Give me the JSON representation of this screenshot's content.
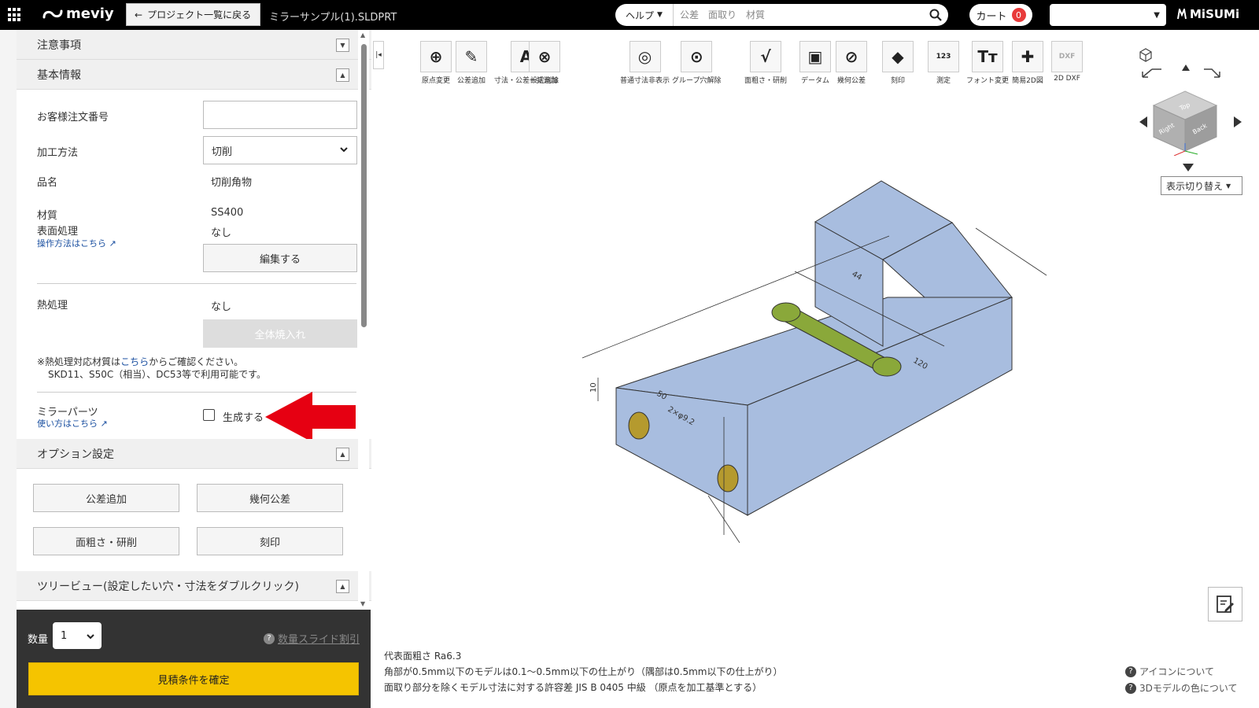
{
  "header": {
    "logo_text": "meviy",
    "back_label": "プロジェクト一覧に戻る",
    "file_name": "ミラーサンプル(1).SLDPRT",
    "help_label": "ヘルプ",
    "search_placeholder": "公差　面取り　材質",
    "cart_label": "カート",
    "cart_count": "0",
    "brand_logo": "MiSUMi"
  },
  "sidebar": {
    "section_caution": "注意事項",
    "section_basic": "基本情報",
    "order_no_label": "お客様注文番号",
    "order_no_value": "",
    "process_label": "加工方法",
    "process_value": "切削",
    "product_label": "品名",
    "product_value": "切削角物",
    "material_label": "材質",
    "material_value": "SS400",
    "surface_label": "表面処理",
    "surface_value": "なし",
    "howto_link": "操作方法はこちら",
    "edit_button": "編集する",
    "heat_label": "熱処理",
    "heat_value": "なし",
    "quench_button": "全体焼入れ",
    "note_prefix": "※熱処理対応材質は",
    "note_link": "こちら",
    "note_suffix": "からご確認ください。",
    "note_line2": "SKD11、S50C（相当）、DC53等で利用可能です。",
    "mirror_label": "ミラーパーツ",
    "mirror_link": "使い方はこちら",
    "mirror_check_label": "生成する",
    "mirror_checked": false,
    "section_option": "オプション設定",
    "opt_tolerance": "公差追加",
    "opt_geometric": "幾何公差",
    "opt_roughness": "面粗さ・研削",
    "opt_engrave": "刻印",
    "section_tree": "ツリービュー(設定したい穴・寸法をダブルクリック)"
  },
  "footer": {
    "qty_label": "数量",
    "qty_value": "1",
    "qty_discount_link": "数量スライド割引",
    "confirm_button": "見積条件を確定"
  },
  "toolbar": [
    {
      "label": "原点変更",
      "icon": "origin-icon"
    },
    {
      "label": "公差追加",
      "icon": "tolerance-add-icon"
    },
    {
      "label": "寸法・公差一括追加",
      "icon": "dimension-bulk-icon"
    },
    {
      "label": "設定削除",
      "icon": "delete-setting-icon"
    },
    {
      "label": "普通寸法非表示",
      "icon": "hide-dimension-icon"
    },
    {
      "label": "グループ穴解除",
      "icon": "group-hole-icon"
    },
    {
      "label": "面粗さ・研削",
      "icon": "roughness-icon"
    },
    {
      "label": "データム",
      "icon": "datum-icon"
    },
    {
      "label": "幾何公差",
      "icon": "geometric-tolerance-icon"
    },
    {
      "label": "刻印",
      "icon": "engrave-icon"
    },
    {
      "label": "測定",
      "icon": "measure-icon"
    },
    {
      "label": "フォント変更",
      "icon": "font-icon"
    },
    {
      "label": "簡易2D図",
      "icon": "simple-2d-icon"
    },
    {
      "label": "2D DXF",
      "icon": "dxf-icon"
    }
  ],
  "viewcube": {
    "display_switch": "表示切り替え",
    "faces": [
      "Right",
      "Back",
      "Top"
    ]
  },
  "model_dims": [
    "44",
    "120",
    "10",
    "50",
    "2×φ9.2"
  ],
  "bottom_notes": {
    "line1": "代表面粗さ Ra6.3",
    "line2": "角部が0.5mm以下のモデルは0.1～0.5mm以下の仕上がり（隅部は0.5mm以下の仕上がり）",
    "line3": "面取り部分を除くモデル寸法に対する許容差 JIS B 0405 中級 （原点を加工基準とする）"
  },
  "help_links": {
    "icons": "アイコンについて",
    "colors": "3Dモデルの色について"
  },
  "colors": {
    "header_bg": "#000000",
    "model_face": "#a8bddf",
    "hole_fill": "#8aa83a",
    "confirm_button": "#f5c400",
    "arrow": "#e60012"
  }
}
